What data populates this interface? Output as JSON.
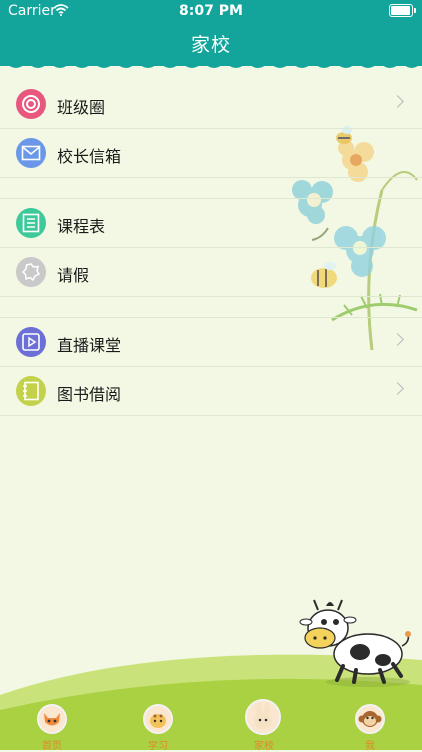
{
  "status_bar": {
    "carrier": "Carrier",
    "time": "8:07 PM"
  },
  "header": {
    "title": "家校"
  },
  "menu": {
    "group1": [
      {
        "label": "班级圈",
        "icon": "circle-target-icon",
        "color": "#e8577e",
        "chevron": true
      },
      {
        "label": "校长信箱",
        "icon": "envelope-icon",
        "color": "#6a97e8",
        "chevron": false
      }
    ],
    "group2": [
      {
        "label": "课程表",
        "icon": "calendar-grid-icon",
        "color": "#3ec99a",
        "chevron": false
      },
      {
        "label": "请假",
        "icon": "badge-icon",
        "color": "#c9c9c9",
        "chevron": false
      }
    ],
    "group3": [
      {
        "label": "直播课堂",
        "icon": "play-icon",
        "color": "#6c6fd6",
        "chevron": true
      },
      {
        "label": "图书借阅",
        "icon": "notebook-icon",
        "color": "#c3d24a",
        "chevron": true
      }
    ]
  },
  "tabbar": {
    "items": [
      {
        "label": "首页",
        "icon": "fox-icon"
      },
      {
        "label": "学习",
        "icon": "giraffe-icon"
      },
      {
        "label": "家校",
        "icon": "rabbit-icon",
        "active": true
      },
      {
        "label": "我",
        "icon": "monkey-icon"
      }
    ]
  },
  "colors": {
    "header": "#13a59b",
    "background": "#f2f8e4",
    "tab_label": "#e08a2e"
  }
}
